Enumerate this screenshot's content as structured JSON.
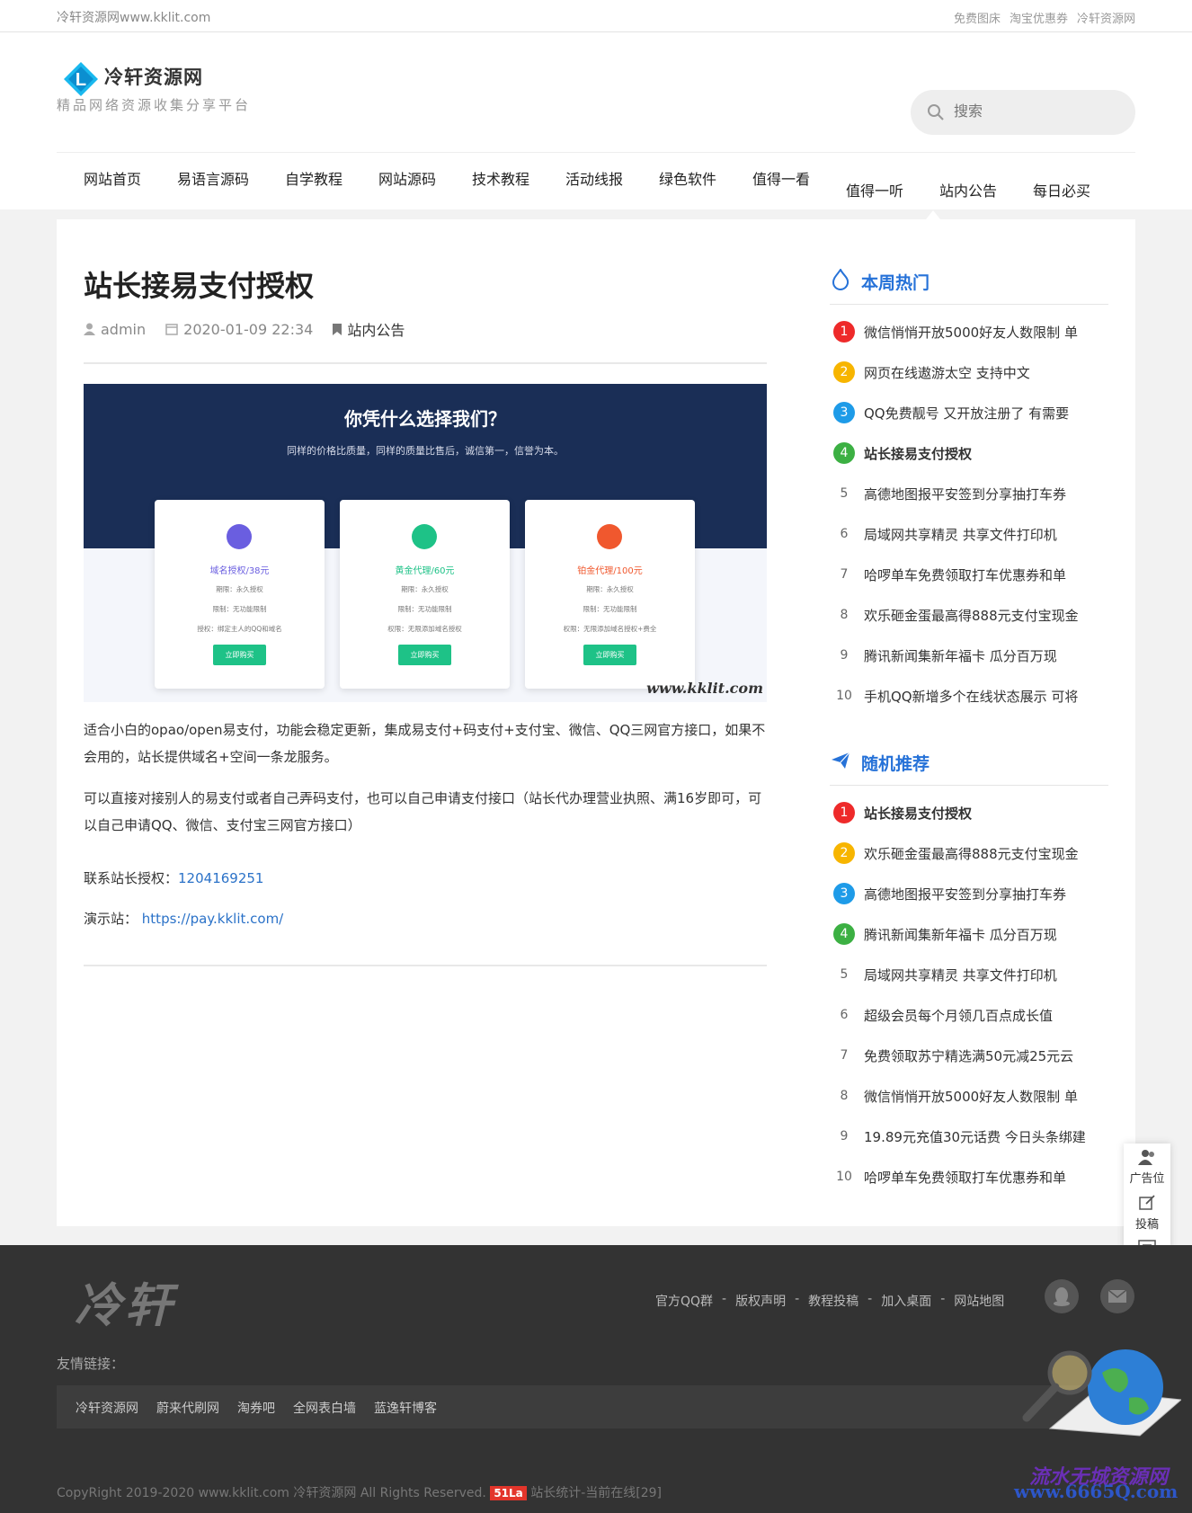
{
  "topbar": {
    "site": "冷轩资源网www.kklit.com",
    "links": [
      "免费图床",
      "淘宝优惠券",
      "冷轩资源网"
    ]
  },
  "header": {
    "logo_title": "冷轩资源网",
    "logo_letter": "L",
    "logo_sub": "精品网络资源收集分享平台",
    "search_placeholder": "搜索"
  },
  "nav": [
    "网站首页",
    "易语言源码",
    "自学教程",
    "网站源码",
    "技术教程",
    "活动线报",
    "绿色软件",
    "值得一看",
    "值得一听",
    "站内公告",
    "每日必买"
  ],
  "article": {
    "title": "站长接易支付授权",
    "author": "admin",
    "date": "2020-01-09 22:34",
    "category": "站内公告",
    "banner": {
      "heading": "你凭什么选择我们？",
      "sub": "同样的价格比质量，同样的质量比售后，诚信第一，信誉为本。",
      "cards": [
        {
          "title": "域名授权/38元",
          "l1": "期限：永久授权",
          "l2": "限制：无功能限制",
          "l3": "授权：绑定主人的QQ和域名",
          "btn": "立即购买",
          "color": "#6a5ee0"
        },
        {
          "title": "黄金代理/60元",
          "l1": "期限：永久授权",
          "l2": "限制：无功能限制",
          "l3": "权限：无限添加域名授权",
          "btn": "立即购买",
          "color": "#1ec287"
        },
        {
          "title": "铂金代理/100元",
          "l1": "期限：永久授权",
          "l2": "限制：无功能限制",
          "l3": "权限：无限添加域名授权+费全",
          "btn": "立即购买",
          "color": "#f0582e"
        }
      ],
      "watermark": "www.kklit.com"
    },
    "p1": "适合小白的opao/open易支付，功能会稳定更新，集成易支付+码支付+支付宝、微信、QQ三网官方接口，如果不会用的，站长提供域名+空间一条龙服务。",
    "p2": "可以直接对接别人的易支付或者自己弄码支付，也可以自己申请支付接口（站长代办理营业执照、满16岁即可，可以自己申请QQ、微信、支付宝三网官方接口）",
    "contact_label": "联系站长授权：",
    "contact_value": "1204169251",
    "demo_label": "演示站：",
    "demo_url": "https://pay.kklit.com/"
  },
  "sidebar": {
    "hot_title": "本周热门",
    "hot": [
      {
        "n": "1",
        "t": "微信悄悄开放5000好友人数限制 单"
      },
      {
        "n": "2",
        "t": "网页在线遨游太空 支持中文"
      },
      {
        "n": "3",
        "t": "QQ免费靓号 又开放注册了 有需要"
      },
      {
        "n": "4",
        "t": "站长接易支付授权"
      },
      {
        "n": "5",
        "t": "高德地图报平安签到分享抽打车券"
      },
      {
        "n": "6",
        "t": "局域网共享精灵 共享文件打印机"
      },
      {
        "n": "7",
        "t": "哈啰单车免费领取打车优惠券和单"
      },
      {
        "n": "8",
        "t": "欢乐砸金蛋最高得888元支付宝现金"
      },
      {
        "n": "9",
        "t": "腾讯新闻集新年福卡 瓜分百万现"
      },
      {
        "n": "10",
        "t": "手机QQ新增多个在线状态展示 可将"
      }
    ],
    "rand_title": "随机推荐",
    "rand": [
      {
        "n": "1",
        "t": "站长接易支付授权"
      },
      {
        "n": "2",
        "t": "欢乐砸金蛋最高得888元支付宝现金"
      },
      {
        "n": "3",
        "t": "高德地图报平安签到分享抽打车券"
      },
      {
        "n": "4",
        "t": "腾讯新闻集新年福卡 瓜分百万现"
      },
      {
        "n": "5",
        "t": "局域网共享精灵 共享文件打印机"
      },
      {
        "n": "6",
        "t": "超级会员每个月领几百点成长值"
      },
      {
        "n": "7",
        "t": "免费领取苏宁精选满50元减25元云"
      },
      {
        "n": "8",
        "t": "微信悄悄开放5000好友人数限制 单"
      },
      {
        "n": "9",
        "t": "19.89元充值30元话费 今日头条绑建"
      },
      {
        "n": "10",
        "t": "哈啰单车免费领取打车优惠券和单"
      }
    ],
    "badge_colors": [
      "#ee2a2a",
      "#f7b500",
      "#1e9be8",
      "#3cb043"
    ]
  },
  "float": {
    "ad": "广告位",
    "post": "投稿",
    "comment": "评论"
  },
  "footer": {
    "logo": "冷轩",
    "links": [
      "官方QQ群",
      "-",
      "版权声明",
      "-",
      "教程投稿",
      "-",
      "加入桌面",
      "-",
      "网站地图"
    ],
    "friend_label": "友情链接：",
    "friends": [
      "冷轩资源网",
      "蔚来代刷网",
      "淘券吧",
      "全网表白墙",
      "蓝逸轩博客"
    ],
    "copy_pre": "CopyRight 2019-2020 www.kklit.com 冷轩资源网 All Rights Reserved.",
    "badge": "51La",
    "copy_post": "站长统计-当前在线[29]",
    "wm_cn": "流水无城资源网",
    "wm_url": "www.6665Q.com"
  }
}
